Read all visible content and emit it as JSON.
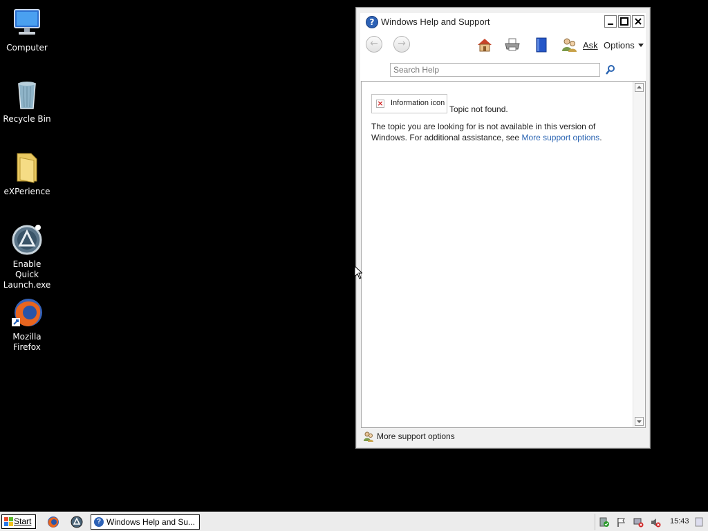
{
  "desktop": {
    "icons": [
      {
        "label": "Computer",
        "icon": "computer-icon"
      },
      {
        "label": "Recycle Bin",
        "icon": "recycle-bin-icon"
      },
      {
        "label": "eXPerience",
        "icon": "folder-icon"
      },
      {
        "label": "Enable Quick Launch.exe",
        "icon": "quick-launch-icon"
      },
      {
        "label": "Mozilla Firefox",
        "icon": "firefox-icon"
      }
    ]
  },
  "help_window": {
    "title": "Windows Help and Support",
    "toolbar": {
      "back": "back-icon",
      "forward": "forward-icon",
      "home": "home-icon",
      "print": "print-icon",
      "browse": "browse-help-icon",
      "ask_icon": "ask-icon",
      "ask_label": "Ask",
      "options_label": "Options"
    },
    "search": {
      "placeholder": "Search Help"
    },
    "content": {
      "image_alt": "Information icon",
      "heading": "Topic not found.",
      "body_text": "The topic you are looking for is not available in this version of Windows. For additional assistance, see",
      "link_text": "More support options",
      "body_end": "."
    },
    "footer": {
      "link": "More support options"
    }
  },
  "taskbar": {
    "start_label": "Start",
    "task_label": "Windows Help and Su...",
    "clock": "15:43"
  },
  "colors": {
    "desktop_bg": "#000000",
    "link": "#2a64b2",
    "help_blue": "#2d62b6"
  }
}
